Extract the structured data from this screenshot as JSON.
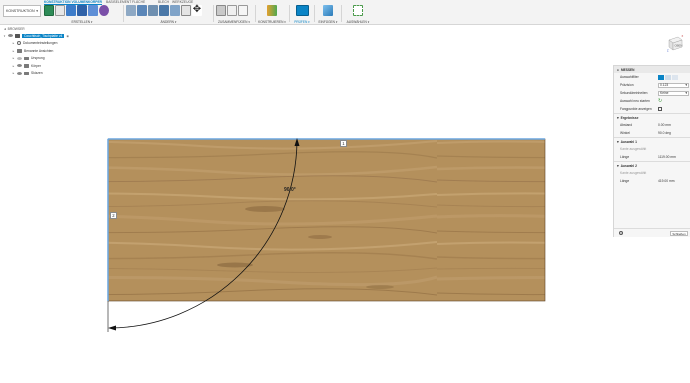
{
  "toolbar": {
    "workspace": "KONSTRUKTION",
    "tabs": [
      "KONSTRUKTION VOLUMENKÖRPER",
      "BASISELEMENT FLÄCHE",
      "BLECH",
      "WERKZEUGE"
    ],
    "active_tab": 0,
    "groups": [
      "ERSTELLEN",
      "ÄNDERN",
      "ZUSAMMENFÜGEN",
      "KONSTRUIEREN",
      "PRÜFEN",
      "EINFÜGEN",
      "AUSWÄHLEN"
    ],
    "accent": "#0a84c6"
  },
  "browser": {
    "title": "BROWSER",
    "root": "Couchtisch_Tischplatte v4",
    "items": [
      "Dokumenteinstellungen",
      "Benannte Ansichten",
      "Ursprung",
      "Körper",
      "Skizzen"
    ]
  },
  "viewcube": {
    "face_label": "OBEN",
    "axes": [
      "X",
      "Z"
    ]
  },
  "measure_panel": {
    "title": "MESSEN",
    "rows": {
      "filter_label": "Auswahlfilter",
      "precision_label": "Präzision",
      "precision_value": "0.123",
      "secondary_label": "Sekundäreinheiten",
      "secondary_value": "Keine",
      "reset_label": "Auswahl neu starten",
      "snap_label": "Fangpunkte anzeigen"
    },
    "results": {
      "title": "Ergebnisse",
      "distance_label": "Abstand",
      "distance_value": "0.00 mm",
      "angle_label": "Winkel",
      "angle_value": "90.0 deg"
    },
    "sel1": {
      "title": "Auswahl 1",
      "hint": "Kante ausgewählt",
      "length_label": "Länge",
      "length_value": "1119.00 mm"
    },
    "sel2": {
      "title": "Auswahl 2",
      "hint": "Kante ausgewählt",
      "length_label": "Länge",
      "length_value": "419.00 mm"
    },
    "close_label": "Schließen"
  },
  "measurement": {
    "angle_text": "90.0°",
    "callout_1": "1",
    "callout_2": "2"
  },
  "colors": {
    "wood_base": "#b4905c",
    "wood_light": "#c8a878",
    "wood_dark": "#94704a",
    "selection": "#6aa6e0"
  }
}
